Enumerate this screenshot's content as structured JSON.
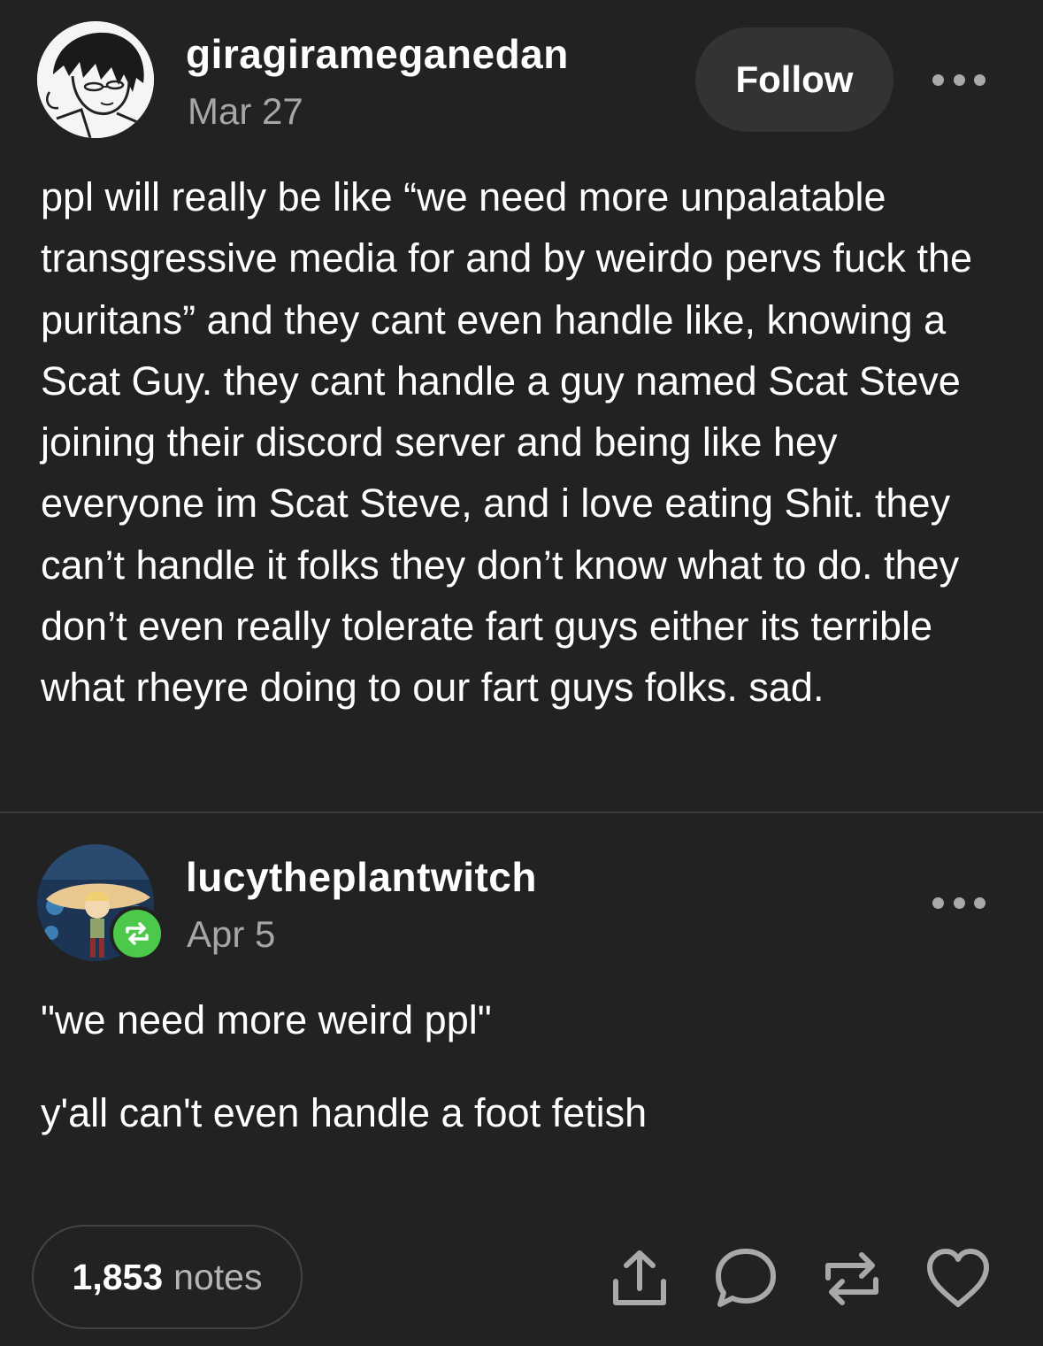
{
  "original_post": {
    "username": "giragirameganedan",
    "date": "Mar 27",
    "follow_label": "Follow",
    "text": "ppl will really be like “we need more unpalatable transgressive media for and by weirdo pervs fuck the puritans” and they cant even handle like, knowing a Scat Guy. they cant handle a guy named Scat Steve joining their discord server and being like hey everyone im Scat Steve, and i love eating Shit. they can’t handle it folks they don’t know what to do. they don’t even really tolerate fart guys either its terrible what rheyre doing to our fart guys folks. sad."
  },
  "reblog": {
    "username": "lucytheplantwitch",
    "date": "Apr 5",
    "paragraphs": [
      "\"we need more weird ppl\"",
      "y'all can't even handle a foot fetish"
    ]
  },
  "footer": {
    "notes_count": "1,853",
    "notes_label": "notes"
  },
  "icons": {
    "more": "more-horizontal-icon",
    "share": "share-icon",
    "reply": "comment-icon",
    "reblog": "reblog-icon",
    "like": "heart-icon",
    "reblog_badge": "reblog-badge-icon"
  },
  "colors": {
    "background": "#222222",
    "text": "#ffffff",
    "muted": "#a6a6a6",
    "button_bg": "#333333",
    "reblog_green": "#4cc94a"
  }
}
